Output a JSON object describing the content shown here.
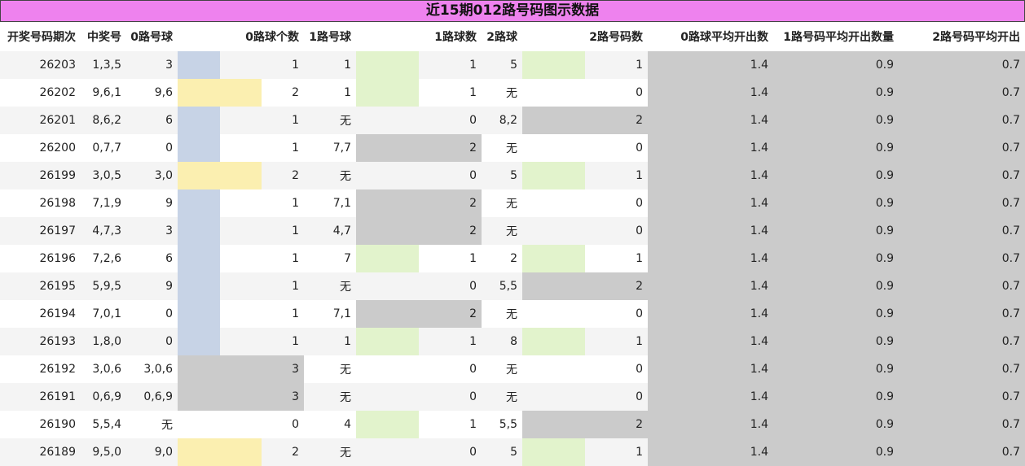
{
  "title": "近15期012路号码图示数据",
  "headers": [
    "开奖号码期次",
    "中奖号",
    "0路号球",
    "0路球个数",
    "1路号球",
    "1路球数",
    "2路球",
    "2路号码数",
    "0路球平均开出数",
    "1路号码平均开出数量",
    "2路号码平均开出"
  ],
  "bar_max": 3,
  "colors": {
    "one": "#c7d3e6",
    "two": "#fbefb0",
    "three": "#cbcbcb",
    "green": "#e2f3cc",
    "avg": "#cbcbcb",
    "title_bg": "#ee82ee"
  },
  "rows": [
    {
      "issue": "26203",
      "nums": "1,3,5",
      "r0": "3",
      "c0": "1",
      "r1": "1",
      "c1": "1",
      "r2": "5",
      "c2": "1",
      "a0": "1.4",
      "a1": "0.9",
      "a2": "0.7"
    },
    {
      "issue": "26202",
      "nums": "9,6,1",
      "r0": "9,6",
      "c0": "2",
      "r1": "1",
      "c1": "1",
      "r2": "无",
      "c2": "0",
      "a0": "1.4",
      "a1": "0.9",
      "a2": "0.7"
    },
    {
      "issue": "26201",
      "nums": "8,6,2",
      "r0": "6",
      "c0": "1",
      "r1": "无",
      "c1": "0",
      "r2": "8,2",
      "c2": "2",
      "a0": "1.4",
      "a1": "0.9",
      "a2": "0.7"
    },
    {
      "issue": "26200",
      "nums": "0,7,7",
      "r0": "0",
      "c0": "1",
      "r1": "7,7",
      "c1": "2",
      "r2": "无",
      "c2": "0",
      "a0": "1.4",
      "a1": "0.9",
      "a2": "0.7"
    },
    {
      "issue": "26199",
      "nums": "3,0,5",
      "r0": "3,0",
      "c0": "2",
      "r1": "无",
      "c1": "0",
      "r2": "5",
      "c2": "1",
      "a0": "1.4",
      "a1": "0.9",
      "a2": "0.7"
    },
    {
      "issue": "26198",
      "nums": "7,1,9",
      "r0": "9",
      "c0": "1",
      "r1": "7,1",
      "c1": "2",
      "r2": "无",
      "c2": "0",
      "a0": "1.4",
      "a1": "0.9",
      "a2": "0.7"
    },
    {
      "issue": "26197",
      "nums": "4,7,3",
      "r0": "3",
      "c0": "1",
      "r1": "4,7",
      "c1": "2",
      "r2": "无",
      "c2": "0",
      "a0": "1.4",
      "a1": "0.9",
      "a2": "0.7"
    },
    {
      "issue": "26196",
      "nums": "7,2,6",
      "r0": "6",
      "c0": "1",
      "r1": "7",
      "c1": "1",
      "r2": "2",
      "c2": "1",
      "a0": "1.4",
      "a1": "0.9",
      "a2": "0.7"
    },
    {
      "issue": "26195",
      "nums": "5,9,5",
      "r0": "9",
      "c0": "1",
      "r1": "无",
      "c1": "0",
      "r2": "5,5",
      "c2": "2",
      "a0": "1.4",
      "a1": "0.9",
      "a2": "0.7"
    },
    {
      "issue": "26194",
      "nums": "7,0,1",
      "r0": "0",
      "c0": "1",
      "r1": "7,1",
      "c1": "2",
      "r2": "无",
      "c2": "0",
      "a0": "1.4",
      "a1": "0.9",
      "a2": "0.7"
    },
    {
      "issue": "26193",
      "nums": "1,8,0",
      "r0": "0",
      "c0": "1",
      "r1": "1",
      "c1": "1",
      "r2": "8",
      "c2": "1",
      "a0": "1.4",
      "a1": "0.9",
      "a2": "0.7"
    },
    {
      "issue": "26192",
      "nums": "3,0,6",
      "r0": "3,0,6",
      "c0": "3",
      "r1": "无",
      "c1": "0",
      "r2": "无",
      "c2": "0",
      "a0": "1.4",
      "a1": "0.9",
      "a2": "0.7"
    },
    {
      "issue": "26191",
      "nums": "0,6,9",
      "r0": "0,6,9",
      "c0": "3",
      "r1": "无",
      "c1": "0",
      "r2": "无",
      "c2": "0",
      "a0": "1.4",
      "a1": "0.9",
      "a2": "0.7"
    },
    {
      "issue": "26190",
      "nums": "5,5,4",
      "r0": "无",
      "c0": "0",
      "r1": "4",
      "c1": "1",
      "r2": "5,5",
      "c2": "2",
      "a0": "1.4",
      "a1": "0.9",
      "a2": "0.7"
    },
    {
      "issue": "26189",
      "nums": "9,5,0",
      "r0": "9,0",
      "c0": "2",
      "r1": "无",
      "c1": "0",
      "r2": "5",
      "c2": "1",
      "a0": "1.4",
      "a1": "0.9",
      "a2": "0.7"
    }
  ]
}
